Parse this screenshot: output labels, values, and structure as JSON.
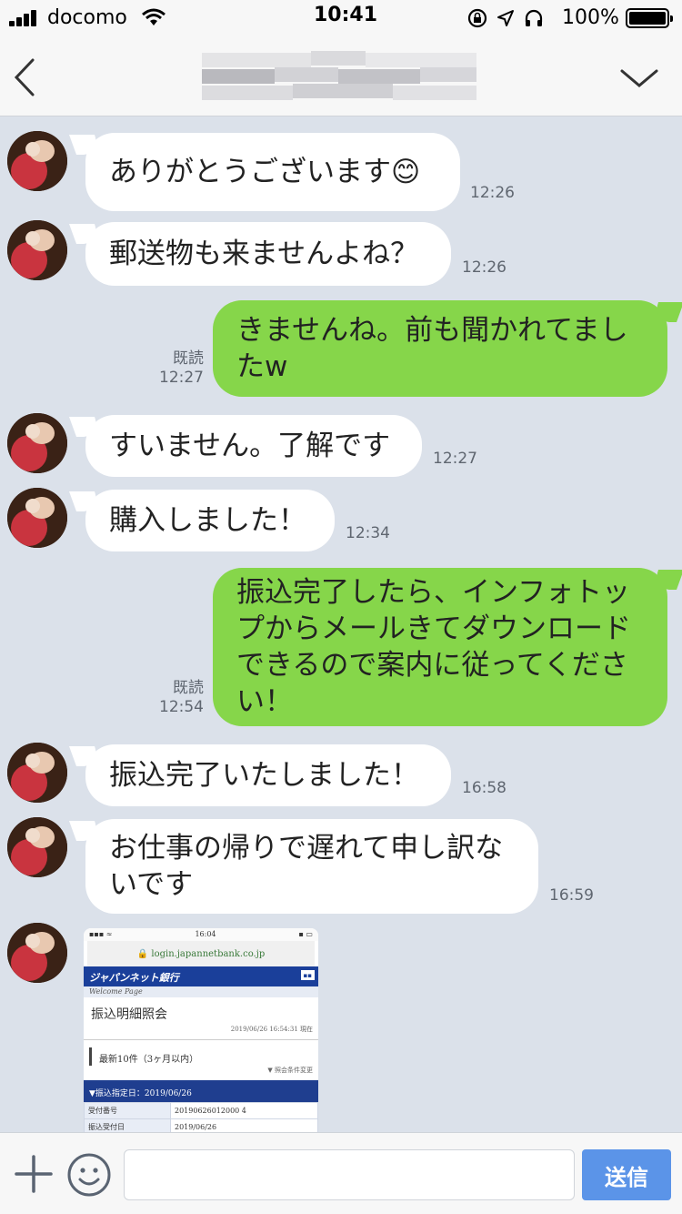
{
  "status_bar": {
    "carrier": "docomo",
    "time": "10:41",
    "battery": "100%",
    "icons": [
      "signal-icon",
      "wifi-icon",
      "rotation-lock-icon",
      "location-icon",
      "headphones-icon",
      "battery-icon"
    ]
  },
  "header": {
    "back_icon": "chevron-left-icon",
    "menu_icon": "chevron-down-icon",
    "title_blurred": true
  },
  "messages": [
    {
      "side": "in",
      "text": "ありがとうございます😊",
      "time": "12:26"
    },
    {
      "side": "in",
      "text": "郵送物も来ませんよね？",
      "time": "12:26"
    },
    {
      "side": "out",
      "text": "きませんね。前も聞かれてまし\nたw",
      "read": "既読",
      "time": "12:27"
    },
    {
      "side": "in",
      "text": "すいません。了解です",
      "time": "12:27"
    },
    {
      "side": "in",
      "text": "購入しました！",
      "time": "12:34"
    },
    {
      "side": "out",
      "text": "振込完了したら、インフォトッ\nプからメールきてダウンロード\nできるので案内に従ってくださ\nい！",
      "read": "既読",
      "time": "12:54"
    },
    {
      "side": "in",
      "text": "振込完了いたしました！",
      "time": "16:58"
    },
    {
      "side": "in",
      "text": "お仕事の帰りで遅れて申し訳な\nいです",
      "time": "16:59"
    }
  ],
  "attached_image": {
    "status_time": "16:04",
    "url": "login.japannetbank.co.jp",
    "bank_name": "ジャパンネット銀行",
    "welcome": "Welcome Page",
    "heading": "振込明細照会",
    "datetime": "2019/06/26 16:54:31 現在",
    "latest": "最新10件（3ヶ月以内）",
    "option": "▼ 照会条件変更",
    "section": "▼振込指定日：2019/06/26",
    "rows": [
      {
        "label": "受付番号",
        "value": "20190626012000 4"
      },
      {
        "label": "振込受付日",
        "value": "2019/06/26"
      }
    ]
  },
  "input_bar": {
    "plus_icon": "plus-icon",
    "emoji_icon": "smiley-icon",
    "placeholder": "",
    "send_label": "送信"
  },
  "colors": {
    "chat_background": "#dbe1ea",
    "incoming_bubble": "#ffffff",
    "outgoing_bubble": "#86d64a",
    "send_button": "#5b94e8"
  }
}
